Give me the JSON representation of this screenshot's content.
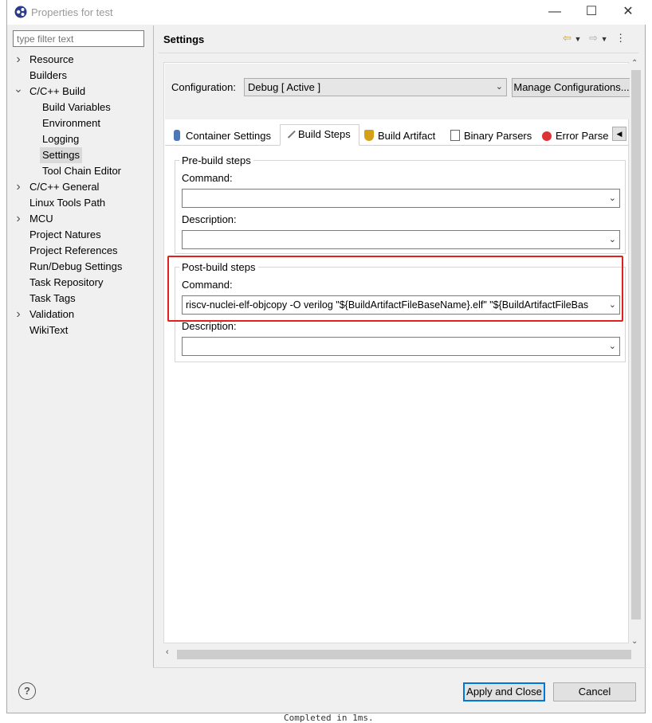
{
  "window": {
    "title": "Properties for test"
  },
  "filter": {
    "placeholder": "type filter text"
  },
  "tree": [
    {
      "label": "Resource",
      "chevron": "right",
      "indent": 0
    },
    {
      "label": "Builders",
      "chevron": "",
      "indent": 0
    },
    {
      "label": "C/C++ Build",
      "chevron": "down",
      "indent": 0
    },
    {
      "label": "Build Variables",
      "chevron": "",
      "indent": 1
    },
    {
      "label": "Environment",
      "chevron": "",
      "indent": 1
    },
    {
      "label": "Logging",
      "chevron": "",
      "indent": 1
    },
    {
      "label": "Settings",
      "chevron": "",
      "indent": 1,
      "selected": true
    },
    {
      "label": "Tool Chain Editor",
      "chevron": "",
      "indent": 1
    },
    {
      "label": "C/C++ General",
      "chevron": "right",
      "indent": 0
    },
    {
      "label": "Linux Tools Path",
      "chevron": "",
      "indent": 0
    },
    {
      "label": "MCU",
      "chevron": "right",
      "indent": 0
    },
    {
      "label": "Project Natures",
      "chevron": "",
      "indent": 0
    },
    {
      "label": "Project References",
      "chevron": "",
      "indent": 0
    },
    {
      "label": "Run/Debug Settings",
      "chevron": "",
      "indent": 0
    },
    {
      "label": "Task Repository",
      "chevron": "",
      "indent": 0
    },
    {
      "label": "Task Tags",
      "chevron": "",
      "indent": 0
    },
    {
      "label": "Validation",
      "chevron": "right",
      "indent": 0
    },
    {
      "label": "WikiText",
      "chevron": "",
      "indent": 0
    }
  ],
  "settings": {
    "title": "Settings"
  },
  "config": {
    "label": "Configuration:",
    "value": "Debug  [ Active ]",
    "manage_button": "Manage Configurations..."
  },
  "tabs": [
    {
      "label": "Container Settings",
      "icon": "container-icon"
    },
    {
      "label": "Build Steps",
      "icon": "build-steps-icon",
      "active": true
    },
    {
      "label": "Build Artifact",
      "icon": "trophy-icon"
    },
    {
      "label": "Binary Parsers",
      "icon": "binary-icon"
    },
    {
      "label": "Error Parse",
      "icon": "error-icon"
    }
  ],
  "prebuild": {
    "group_label": "Pre-build steps",
    "command_label": "Command:",
    "command_value": "",
    "description_label": "Description:",
    "description_value": ""
  },
  "postbuild": {
    "group_label": "Post-build steps",
    "command_label": "Command:",
    "command_value": "riscv-nuclei-elf-objcopy -O verilog \"${BuildArtifactFileBaseName}.elf\" \"${BuildArtifactFileBas",
    "description_label": "Description:",
    "description_value": ""
  },
  "footer": {
    "help_symbol": "?",
    "apply_button": "Apply and Close",
    "cancel_button": "Cancel"
  },
  "background": {
    "status_text": "Completed in 1ms."
  },
  "colors": {
    "highlight_box": "#e0201c",
    "selection": "#d9d9d9",
    "default_button_border": "#0078d7"
  }
}
